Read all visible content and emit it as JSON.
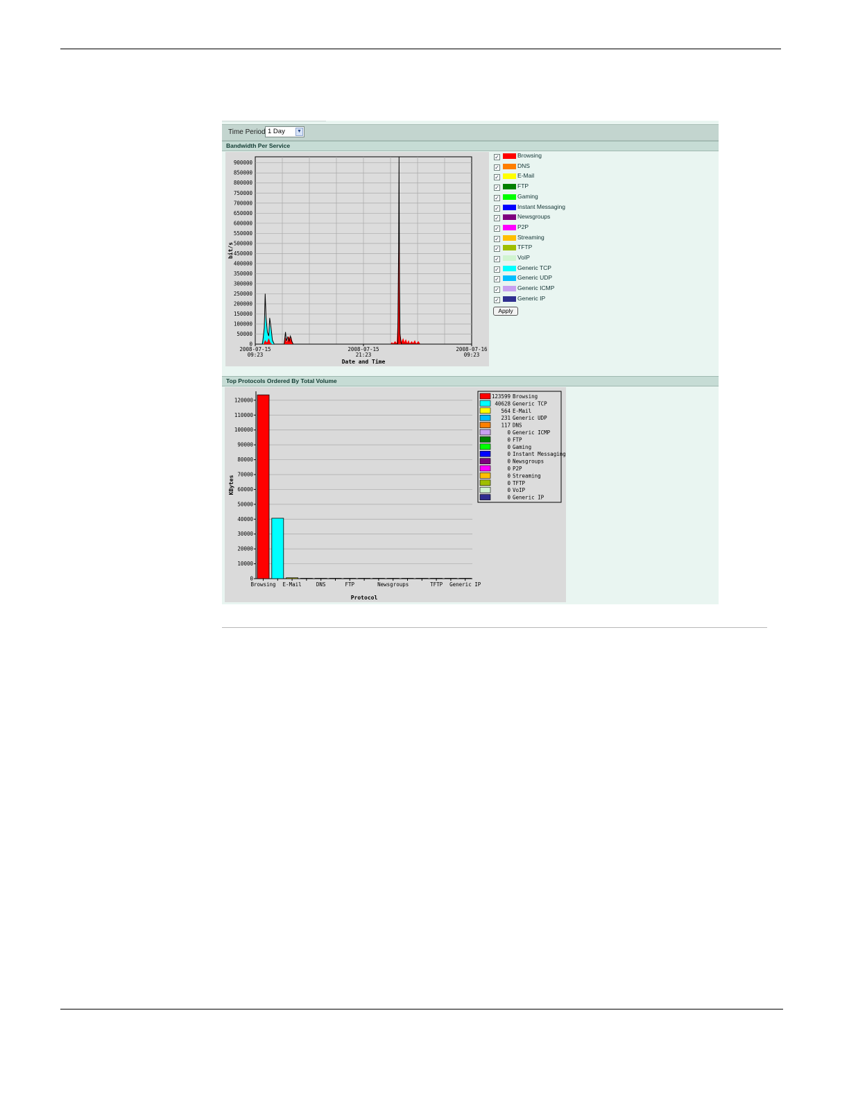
{
  "time_period": {
    "label": "Time Period",
    "selected": "1 Day"
  },
  "bandwidth": {
    "title": "Bandwidth Per Service",
    "apply_label": "Apply",
    "services": [
      {
        "name": "Browsing",
        "color": "#ff0000",
        "checked": true
      },
      {
        "name": "DNS",
        "color": "#ff7f00",
        "checked": true
      },
      {
        "name": "E-Mail",
        "color": "#ffff00",
        "checked": true
      },
      {
        "name": "FTP",
        "color": "#007f00",
        "checked": true
      },
      {
        "name": "Gaming",
        "color": "#00ff00",
        "checked": true
      },
      {
        "name": "Instant Messaging",
        "color": "#0000ff",
        "checked": true
      },
      {
        "name": "Newsgroups",
        "color": "#7f007f",
        "checked": true
      },
      {
        "name": "P2P",
        "color": "#ff00ff",
        "checked": true
      },
      {
        "name": "Streaming",
        "color": "#ffbf00",
        "checked": true
      },
      {
        "name": "TFTP",
        "color": "#9fbf00",
        "checked": true
      },
      {
        "name": "VoIP",
        "color": "#d0f4d0",
        "checked": true
      },
      {
        "name": "Generic TCP",
        "color": "#00ffff",
        "checked": true
      },
      {
        "name": "Generic UDP",
        "color": "#00bfff",
        "checked": true
      },
      {
        "name": "Generic ICMP",
        "color": "#c8a0f0",
        "checked": true
      },
      {
        "name": "Generic IP",
        "color": "#2f2f8f",
        "checked": true
      }
    ]
  },
  "top_protocols": {
    "title": "Top Protocols Ordered By Total Volume"
  },
  "chart_data": [
    {
      "type": "area",
      "xlabel": "Date and Time",
      "ylabel": "bit/s",
      "ylim": [
        0,
        930000
      ],
      "yticks": [
        0,
        50000,
        100000,
        150000,
        200000,
        250000,
        300000,
        350000,
        400000,
        450000,
        500000,
        550000,
        600000,
        650000,
        700000,
        750000,
        800000,
        850000,
        900000
      ],
      "xlim_hours": [
        0,
        24
      ],
      "xticks": [
        {
          "hour": 0,
          "date": "2008-07-15",
          "time": "09:23"
        },
        {
          "hour": 12,
          "date": "2008-07-15",
          "time": "21:23"
        },
        {
          "hour": 24,
          "date": "2008-07-16",
          "time": "09:23"
        }
      ],
      "grid": true,
      "series": [
        {
          "name": "Generic TCP",
          "color": "#00ffff",
          "points": [
            [
              0,
              0
            ],
            [
              0.7,
              0
            ],
            [
              1.0,
              60000
            ],
            [
              1.15,
              150000
            ],
            [
              1.3,
              70000
            ],
            [
              1.45,
              30000
            ],
            [
              1.6,
              100000
            ],
            [
              1.75,
              60000
            ],
            [
              1.9,
              20000
            ],
            [
              2.1,
              0
            ],
            [
              3.5,
              0
            ],
            [
              3.6,
              20000
            ],
            [
              3.75,
              5000
            ],
            [
              3.9,
              25000
            ],
            [
              4.05,
              10000
            ],
            [
              4.2,
              0
            ]
          ]
        },
        {
          "name": "Browsing",
          "color": "#ff0000",
          "points": [
            [
              0,
              0
            ],
            [
              0.9,
              0
            ],
            [
              1.1,
              20000
            ],
            [
              1.3,
              8000
            ],
            [
              1.5,
              30000
            ],
            [
              1.7,
              5000
            ],
            [
              1.9,
              0
            ],
            [
              3.2,
              0
            ],
            [
              3.35,
              35000
            ],
            [
              3.45,
              10000
            ],
            [
              3.55,
              15000
            ],
            [
              3.7,
              40000
            ],
            [
              3.85,
              25000
            ],
            [
              4.0,
              35000
            ],
            [
              4.15,
              0
            ],
            [
              15.0,
              0
            ],
            [
              15.15,
              10000
            ],
            [
              15.3,
              3000
            ],
            [
              15.5,
              15000
            ],
            [
              15.7,
              5000
            ],
            [
              15.85,
              170000
            ],
            [
              15.9,
              470000
            ],
            [
              15.95,
              780000
            ],
            [
              16.0,
              300000
            ],
            [
              16.05,
              60000
            ],
            [
              16.2,
              10000
            ],
            [
              16.4,
              30000
            ],
            [
              16.55,
              10000
            ],
            [
              16.7,
              25000
            ],
            [
              16.85,
              5000
            ],
            [
              17.0,
              20000
            ],
            [
              17.15,
              3000
            ],
            [
              17.35,
              15000
            ],
            [
              17.5,
              5000
            ],
            [
              17.7,
              20000
            ],
            [
              17.85,
              3000
            ],
            [
              18.1,
              15000
            ],
            [
              18.3,
              0
            ],
            [
              24,
              0
            ]
          ]
        }
      ],
      "outline": [
        [
          0,
          0
        ],
        [
          0.8,
          0
        ],
        [
          1.0,
          80000
        ],
        [
          1.1,
          250000
        ],
        [
          1.2,
          130000
        ],
        [
          1.35,
          60000
        ],
        [
          1.5,
          40000
        ],
        [
          1.6,
          130000
        ],
        [
          1.75,
          80000
        ],
        [
          1.9,
          20000
        ],
        [
          2.1,
          0
        ],
        [
          3.2,
          0
        ],
        [
          3.35,
          60000
        ],
        [
          3.45,
          15000
        ],
        [
          3.6,
          35000
        ],
        [
          3.75,
          15000
        ],
        [
          3.9,
          40000
        ],
        [
          4.05,
          15000
        ],
        [
          4.2,
          0
        ],
        [
          15.8,
          0
        ],
        [
          15.9,
          480000
        ],
        [
          15.95,
          930000
        ],
        [
          16.0,
          300000
        ],
        [
          16.05,
          50000
        ],
        [
          16.2,
          0
        ],
        [
          24,
          0
        ]
      ]
    },
    {
      "type": "bar",
      "xlabel": "Protocol",
      "ylabel": "KBytes",
      "ylim": [
        0,
        126000
      ],
      "yticks": [
        0,
        10000,
        20000,
        30000,
        40000,
        50000,
        60000,
        70000,
        80000,
        90000,
        100000,
        110000,
        120000
      ],
      "categories": [
        "Browsing",
        "Generic TCP",
        "E-Mail",
        "Generic UDP",
        "DNS",
        "Generic ICMP",
        "FTP",
        "Gaming",
        "Instant Messaging",
        "Newsgroups",
        "P2P",
        "Streaming",
        "TFTP",
        "VoIP",
        "Generic IP"
      ],
      "tick_labels": [
        "Browsing",
        "E-Mail",
        "DNS",
        "FTP",
        "Newsgroups",
        "TFTP",
        "Generic IP"
      ],
      "values": [
        123599,
        40628,
        564,
        231,
        117,
        0,
        0,
        0,
        0,
        0,
        0,
        0,
        0,
        0,
        0
      ],
      "colors": [
        "#ff0000",
        "#00ffff",
        "#ffff00",
        "#00bfff",
        "#ff7f00",
        "#c8a0f0",
        "#007f00",
        "#00ff00",
        "#0000ff",
        "#7f007f",
        "#ff00ff",
        "#ffbf00",
        "#9fbf00",
        "#d0f4d0",
        "#2f2f8f"
      ],
      "legend_entries": [
        {
          "value": "123599",
          "name": "Browsing"
        },
        {
          "value": "40628",
          "name": "Generic TCP"
        },
        {
          "value": "564",
          "name": "E-Mail"
        },
        {
          "value": "231",
          "name": "Generic UDP"
        },
        {
          "value": "117",
          "name": "DNS"
        },
        {
          "value": "0",
          "name": "Generic ICMP"
        },
        {
          "value": "0",
          "name": "FTP"
        },
        {
          "value": "0",
          "name": "Gaming"
        },
        {
          "value": "0",
          "name": "Instant Messaging"
        },
        {
          "value": "0",
          "name": "Newsgroups"
        },
        {
          "value": "0",
          "name": "P2P"
        },
        {
          "value": "0",
          "name": "Streaming"
        },
        {
          "value": "0",
          "name": "TFTP"
        },
        {
          "value": "0",
          "name": "VoIP"
        },
        {
          "value": "0",
          "name": "Generic IP"
        }
      ],
      "legend_position": "top-right"
    }
  ]
}
